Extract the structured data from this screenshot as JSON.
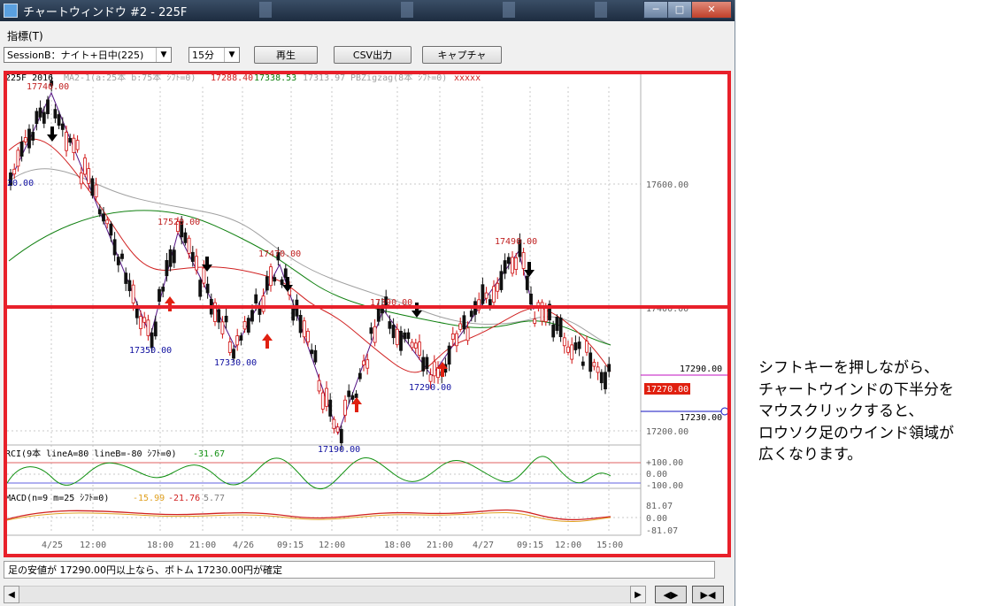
{
  "window": {
    "title": "チャートウィンドウ #2 - 225F"
  },
  "caption_buttons": [
    "─",
    "□",
    "✕"
  ],
  "menu": {
    "indicators": "指標(T)"
  },
  "toolbar": {
    "session_select": "SessionB：ナイト+日中(225)",
    "interval_select": "15分",
    "play_label": "再生",
    "csv_label": "CSV出力",
    "capture_label": "キャプチャ"
  },
  "chart": {
    "header_symbol": "225F 2016",
    "header_ma": "MA2-1(a:25本 b:75本 ｼﾌﾄ=0)",
    "header_ma_a": "17288.40",
    "header_ma_b": "17338.53",
    "header_ma_c": "17313.97",
    "header_zigzag": "PBZigzag(8本 ｼﾌﾄ=0)",
    "header_x": "xxxxx",
    "price_ticks": [
      "17600.00",
      "17400.00",
      "17200.00"
    ],
    "price_labels": {
      "upper": "17290.00",
      "current": "17270.00",
      "lower": "17230.00"
    },
    "highs": [
      "17740.00",
      "17520.00",
      "17470.00",
      "17390.00",
      "17490.00"
    ],
    "lows": [
      "20.00",
      "17350.00",
      "17330.00",
      "17190.00",
      "17290.00"
    ],
    "rci": {
      "label": "RCI(9本 lineA=80 lineB=-80 ｼﾌﾄ=0)",
      "value": "-31.67",
      "ticks": [
        "+100.00",
        "0.00",
        "-100.00"
      ]
    },
    "macd": {
      "label": "MACD(n=9 m=25 ｼﾌﾄ=0)",
      "v1": "-15.99",
      "v2": "-21.76",
      "v3": "5.77",
      "ticks": [
        "81.07",
        "0.00",
        "-81.07"
      ]
    },
    "time_labels": [
      "4/25",
      "12:00",
      "18:00",
      "21:00",
      "4/26",
      "09:15",
      "12:00",
      "18:00",
      "21:00",
      "4/27",
      "09:15",
      "12:00",
      "15:00"
    ],
    "colors": {
      "up": "#d01010",
      "down": "#101010",
      "ma_a": "#d02020",
      "ma_b": "#a0a0a0",
      "ma_c": "#108010",
      "zigzag": "#1010c0",
      "highlight": "#e8202a"
    }
  },
  "status": {
    "text": "足の安値が 17290.00円以上なら、ボトム 17230.00円が確定"
  },
  "navigation": {
    "left": "◀",
    "right": "▶",
    "first": "◀▶",
    "last": "▶◀"
  },
  "note": {
    "text": "シフトキーを押しながら、\nチャートウインドの下半分を\nマウスクリックすると、\nロウソク足のウインド領域が\n広くなります。"
  }
}
